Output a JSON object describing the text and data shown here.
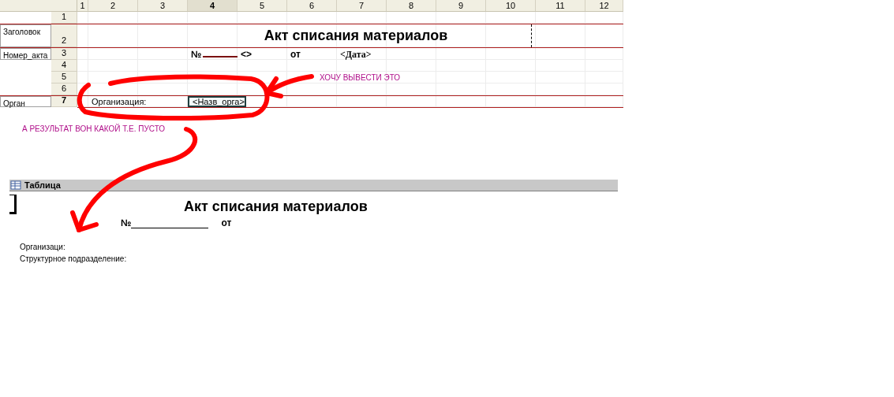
{
  "designer": {
    "columns": [
      {
        "label": "1",
        "selected": false
      },
      {
        "label": "2",
        "selected": false
      },
      {
        "label": "3",
        "selected": false
      },
      {
        "label": "4",
        "selected": true
      },
      {
        "label": "5",
        "selected": false
      },
      {
        "label": "6",
        "selected": false
      },
      {
        "label": "7",
        "selected": false
      },
      {
        "label": "8",
        "selected": false
      },
      {
        "label": "9",
        "selected": false
      },
      {
        "label": "10",
        "selected": false
      },
      {
        "label": "11",
        "selected": false
      },
      {
        "label": "12",
        "selected": false
      }
    ],
    "rows": [
      {
        "number": "1",
        "selected": false
      },
      {
        "number": "2",
        "selected": false,
        "section": "Заголовок",
        "cells": [
          {
            "text": "Акт списания материалов",
            "selected": false
          }
        ]
      },
      {
        "number": "3",
        "selected": false,
        "section": "Номер_акта",
        "cells": [
          {
            "text": "№",
            "selected": false
          },
          {
            "text": "<>",
            "selected": false
          },
          {
            "text": "от",
            "selected": false
          },
          {
            "text": "<Дата>",
            "selected": false
          }
        ]
      },
      {
        "number": "4",
        "selected": false
      },
      {
        "number": "5",
        "selected": false
      },
      {
        "number": "6",
        "selected": false
      },
      {
        "number": "7",
        "selected": true,
        "section": "Орган",
        "cells": [
          {
            "text": "Организация:",
            "selected": false
          },
          {
            "text": "<Назв_орга>",
            "selected": true
          }
        ]
      }
    ]
  },
  "annotations": [
    {
      "text": "ХОЧУ ВЫВЕСТИ ЭТО"
    },
    {
      "text": "А РЕЗУЛЬТАТ ВОН КАКОЙ Т.Е. ПУСТО"
    }
  ],
  "result": {
    "title": "Таблица",
    "heading": "Акт списания материалов",
    "number_sign": "№",
    "from": "от",
    "lines": [
      "Организаци:",
      "Структурное подразделение:"
    ]
  }
}
